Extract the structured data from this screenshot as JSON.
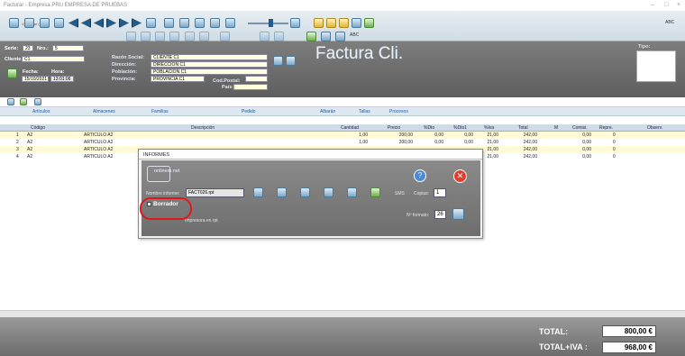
{
  "window": {
    "title": "Facturar - Empresa PRU EMPRESA DE PRUEBAS",
    "toolbar_tag": "Visualizar (F6)",
    "corner_label": "ABC"
  },
  "header": {
    "serie_label": "Serie:",
    "serie_value": "23",
    "nro_label": "Nro.:",
    "nro_value": "5",
    "cliente_label": "Cliente:",
    "cliente_value": "C1",
    "fecha_label": "Fecha:",
    "fecha_value": "15/10/2021",
    "hora_label": "Hora:",
    "hora_value": "13:01:06",
    "razon_label": "Razón Social:",
    "razon_value": "CLIENTE C1",
    "direccion_label": "Dirección:",
    "direccion_value": "DIRECCION C1",
    "poblacion_label": "Población:",
    "poblacion_value": "POBLACION C1",
    "provincia_label": "Provincia:",
    "provincia_value": "PROVINCIA C1",
    "cp_label": "Cod.Postal:",
    "pais_label": "País:",
    "doc_title": "Factura Cli.",
    "tipo_label": "Tipo:"
  },
  "subtabs": [
    "Artículos",
    "Almacenes",
    "Familias",
    "Pedido",
    "Albarán",
    "Tallas",
    "Procesos"
  ],
  "table": {
    "headers": [
      "Código",
      "Descripción",
      "Cantidad",
      "Precio",
      "%Dto",
      "%Dto1",
      "%Iva",
      "Total",
      "M",
      "Comisi.",
      "Repre.",
      "Observ."
    ],
    "rows": [
      {
        "n": "1",
        "codigo": "A2",
        "desc": "ARTICULO A2",
        "cantidad": "1,00",
        "precio": "200,00",
        "dto": "0,00",
        "dto1": "0,00",
        "iva": "21,00",
        "total": "242,00",
        "comisi": "0,00",
        "repre": "0"
      },
      {
        "n": "2",
        "codigo": "A2",
        "desc": "ARTICULO A2",
        "cantidad": "1,00",
        "precio": "200,00",
        "dto": "0,00",
        "dto1": "0,00",
        "iva": "21,00",
        "total": "242,00",
        "comisi": "0,00",
        "repre": "0"
      },
      {
        "n": "3",
        "codigo": "A2",
        "desc": "ARTICULO A2",
        "cantidad": "",
        "precio": "",
        "dto": "",
        "dto1": "",
        "iva": "21,00",
        "total": "242,00",
        "comisi": "0,00",
        "repre": "0"
      },
      {
        "n": "4",
        "codigo": "A2",
        "desc": "ARTICULO A2",
        "cantidad": "",
        "precio": "",
        "dto": "",
        "dto1": "",
        "iva": "21,00",
        "total": "242,00",
        "comisi": "0,00",
        "repre": "0"
      }
    ]
  },
  "totals": {
    "total_label": "TOTAL:",
    "total_value": "800,00 €",
    "iva_label": "TOTAL+IVA :",
    "iva_value": "968,00 €"
  },
  "dialog": {
    "title": "INFORMES",
    "logo_text": "onlinem.net",
    "informe_label": "Nombre informe:",
    "informe_value": "FACT026.rpt",
    "borrador_label": "Borrador",
    "impresora_label": "Impresora en rpt",
    "copias_label": "Copias:",
    "copias_value": "1",
    "formato_label": "Nº formato:",
    "formato_value": "26",
    "sms_label": "SMS"
  },
  "colors": {
    "accent": "#235a86",
    "header_bg": "#6e6e6e",
    "row_alt": "#fffbd6",
    "highlight": "#e01818"
  }
}
